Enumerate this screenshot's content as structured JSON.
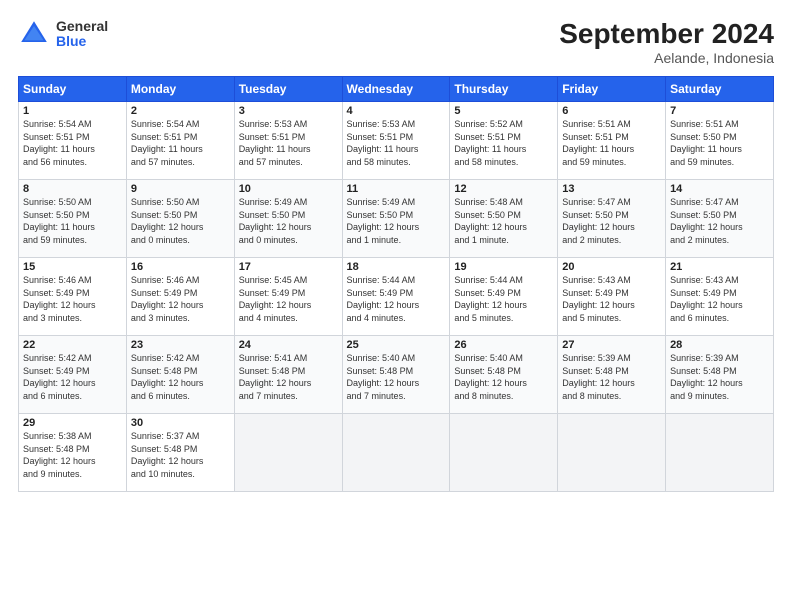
{
  "logo": {
    "general": "General",
    "blue": "Blue"
  },
  "title": "September 2024",
  "subtitle": "Aelande, Indonesia",
  "days_header": [
    "Sunday",
    "Monday",
    "Tuesday",
    "Wednesday",
    "Thursday",
    "Friday",
    "Saturday"
  ],
  "weeks": [
    [
      {
        "day": "1",
        "info": "Sunrise: 5:54 AM\nSunset: 5:51 PM\nDaylight: 11 hours\nand 56 minutes."
      },
      {
        "day": "2",
        "info": "Sunrise: 5:54 AM\nSunset: 5:51 PM\nDaylight: 11 hours\nand 57 minutes."
      },
      {
        "day": "3",
        "info": "Sunrise: 5:53 AM\nSunset: 5:51 PM\nDaylight: 11 hours\nand 57 minutes."
      },
      {
        "day": "4",
        "info": "Sunrise: 5:53 AM\nSunset: 5:51 PM\nDaylight: 11 hours\nand 58 minutes."
      },
      {
        "day": "5",
        "info": "Sunrise: 5:52 AM\nSunset: 5:51 PM\nDaylight: 11 hours\nand 58 minutes."
      },
      {
        "day": "6",
        "info": "Sunrise: 5:51 AM\nSunset: 5:51 PM\nDaylight: 11 hours\nand 59 minutes."
      },
      {
        "day": "7",
        "info": "Sunrise: 5:51 AM\nSunset: 5:50 PM\nDaylight: 11 hours\nand 59 minutes."
      }
    ],
    [
      {
        "day": "8",
        "info": "Sunrise: 5:50 AM\nSunset: 5:50 PM\nDaylight: 11 hours\nand 59 minutes."
      },
      {
        "day": "9",
        "info": "Sunrise: 5:50 AM\nSunset: 5:50 PM\nDaylight: 12 hours\nand 0 minutes."
      },
      {
        "day": "10",
        "info": "Sunrise: 5:49 AM\nSunset: 5:50 PM\nDaylight: 12 hours\nand 0 minutes."
      },
      {
        "day": "11",
        "info": "Sunrise: 5:49 AM\nSunset: 5:50 PM\nDaylight: 12 hours\nand 1 minute."
      },
      {
        "day": "12",
        "info": "Sunrise: 5:48 AM\nSunset: 5:50 PM\nDaylight: 12 hours\nand 1 minute."
      },
      {
        "day": "13",
        "info": "Sunrise: 5:47 AM\nSunset: 5:50 PM\nDaylight: 12 hours\nand 2 minutes."
      },
      {
        "day": "14",
        "info": "Sunrise: 5:47 AM\nSunset: 5:50 PM\nDaylight: 12 hours\nand 2 minutes."
      }
    ],
    [
      {
        "day": "15",
        "info": "Sunrise: 5:46 AM\nSunset: 5:49 PM\nDaylight: 12 hours\nand 3 minutes."
      },
      {
        "day": "16",
        "info": "Sunrise: 5:46 AM\nSunset: 5:49 PM\nDaylight: 12 hours\nand 3 minutes."
      },
      {
        "day": "17",
        "info": "Sunrise: 5:45 AM\nSunset: 5:49 PM\nDaylight: 12 hours\nand 4 minutes."
      },
      {
        "day": "18",
        "info": "Sunrise: 5:44 AM\nSunset: 5:49 PM\nDaylight: 12 hours\nand 4 minutes."
      },
      {
        "day": "19",
        "info": "Sunrise: 5:44 AM\nSunset: 5:49 PM\nDaylight: 12 hours\nand 5 minutes."
      },
      {
        "day": "20",
        "info": "Sunrise: 5:43 AM\nSunset: 5:49 PM\nDaylight: 12 hours\nand 5 minutes."
      },
      {
        "day": "21",
        "info": "Sunrise: 5:43 AM\nSunset: 5:49 PM\nDaylight: 12 hours\nand 6 minutes."
      }
    ],
    [
      {
        "day": "22",
        "info": "Sunrise: 5:42 AM\nSunset: 5:49 PM\nDaylight: 12 hours\nand 6 minutes."
      },
      {
        "day": "23",
        "info": "Sunrise: 5:42 AM\nSunset: 5:48 PM\nDaylight: 12 hours\nand 6 minutes."
      },
      {
        "day": "24",
        "info": "Sunrise: 5:41 AM\nSunset: 5:48 PM\nDaylight: 12 hours\nand 7 minutes."
      },
      {
        "day": "25",
        "info": "Sunrise: 5:40 AM\nSunset: 5:48 PM\nDaylight: 12 hours\nand 7 minutes."
      },
      {
        "day": "26",
        "info": "Sunrise: 5:40 AM\nSunset: 5:48 PM\nDaylight: 12 hours\nand 8 minutes."
      },
      {
        "day": "27",
        "info": "Sunrise: 5:39 AM\nSunset: 5:48 PM\nDaylight: 12 hours\nand 8 minutes."
      },
      {
        "day": "28",
        "info": "Sunrise: 5:39 AM\nSunset: 5:48 PM\nDaylight: 12 hours\nand 9 minutes."
      }
    ],
    [
      {
        "day": "29",
        "info": "Sunrise: 5:38 AM\nSunset: 5:48 PM\nDaylight: 12 hours\nand 9 minutes."
      },
      {
        "day": "30",
        "info": "Sunrise: 5:37 AM\nSunset: 5:48 PM\nDaylight: 12 hours\nand 10 minutes."
      },
      {
        "day": "",
        "info": ""
      },
      {
        "day": "",
        "info": ""
      },
      {
        "day": "",
        "info": ""
      },
      {
        "day": "",
        "info": ""
      },
      {
        "day": "",
        "info": ""
      }
    ]
  ]
}
